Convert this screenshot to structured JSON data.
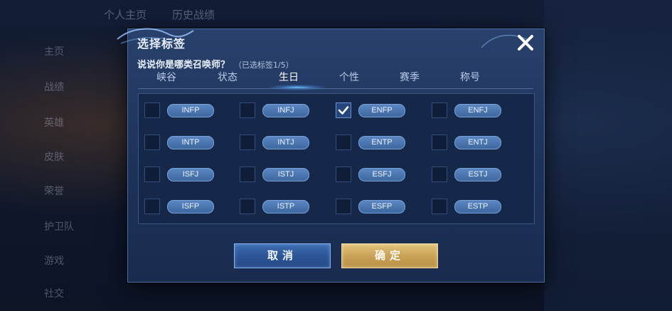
{
  "background": {
    "top_tabs": [
      "个人主页",
      "历史战绩"
    ],
    "sidebar_items": [
      "主页",
      "战绩",
      "英雄",
      "皮肤",
      "荣誉",
      "护卫队",
      "游戏",
      "社交"
    ]
  },
  "dialog": {
    "title": "选择标签",
    "prompt": "说说你是哪类召唤师？",
    "selected_count": "（已选标签1/5）",
    "tabs": [
      {
        "label": "峡谷"
      },
      {
        "label": "状态"
      },
      {
        "label": "生日"
      },
      {
        "label": "个性"
      },
      {
        "label": "赛季"
      },
      {
        "label": "称号"
      }
    ],
    "active_tab": "生日",
    "tags": [
      {
        "label": "INFP",
        "checked": false
      },
      {
        "label": "INFJ",
        "checked": false
      },
      {
        "label": "ENFP",
        "checked": true
      },
      {
        "label": "ENFJ",
        "checked": false
      },
      {
        "label": "INTP",
        "checked": false
      },
      {
        "label": "INTJ",
        "checked": false
      },
      {
        "label": "ENTP",
        "checked": false
      },
      {
        "label": "ENTJ",
        "checked": false
      },
      {
        "label": "ISFJ",
        "checked": false
      },
      {
        "label": "ISTJ",
        "checked": false
      },
      {
        "label": "ESFJ",
        "checked": false
      },
      {
        "label": "ESTJ",
        "checked": false
      },
      {
        "label": "ISFP",
        "checked": false
      },
      {
        "label": "ISTP",
        "checked": false
      },
      {
        "label": "ESFP",
        "checked": false
      },
      {
        "label": "ESTP",
        "checked": false
      }
    ],
    "cancel_label": "取消",
    "ok_label": "确定"
  },
  "colors": {
    "accent_blue": "#3e679f",
    "confirm_gold": "#c9a257",
    "check_white": "#ffffff"
  }
}
